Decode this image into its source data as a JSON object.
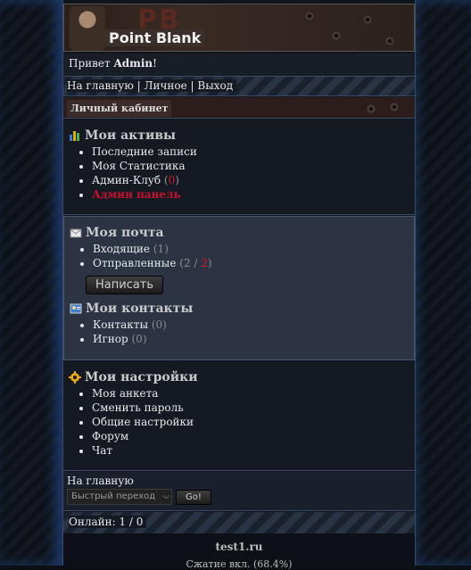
{
  "banner": {
    "logo_text": "Point Blank",
    "logo_bg_text": "PB"
  },
  "greeting": {
    "prefix": "Привет",
    "user": "Admin",
    "suffix": "!"
  },
  "nav": {
    "home": "На главную",
    "personal": "Личное",
    "logout": "Выход",
    "sep": " | "
  },
  "tab": {
    "label": "Личный кабинет"
  },
  "assets": {
    "title": "Мои активы",
    "items": {
      "recent": "Последние записи",
      "stats": "Моя Статистика",
      "club": "Админ-Клуб",
      "club_count": "0",
      "panel": "Админ панель"
    }
  },
  "mail": {
    "title": "Моя почта",
    "inbox": "Входящие",
    "inbox_count": "1",
    "sent": "Отправленные",
    "sent_a": "2",
    "sent_b": "2",
    "write_button": "Написать"
  },
  "contacts": {
    "title": "Мои контакты",
    "contacts": "Контакты",
    "contacts_count": "0",
    "ignore": "Игнор",
    "ignore_count": "0"
  },
  "settings": {
    "title": "Мои настройки",
    "items": {
      "profile": "Моя анкета",
      "password": "Сменить пароль",
      "general": "Общие настройки",
      "forum": "Форум",
      "chat": "Чат"
    }
  },
  "quick": {
    "home": "На главную",
    "select_value": "Быстрый переход",
    "go": "Go!"
  },
  "online": {
    "label": "Онлайн:",
    "value": "1 / 0"
  },
  "footer": {
    "site": "test1.ru",
    "partial": "Сжатие вкл. (68.4%)"
  }
}
